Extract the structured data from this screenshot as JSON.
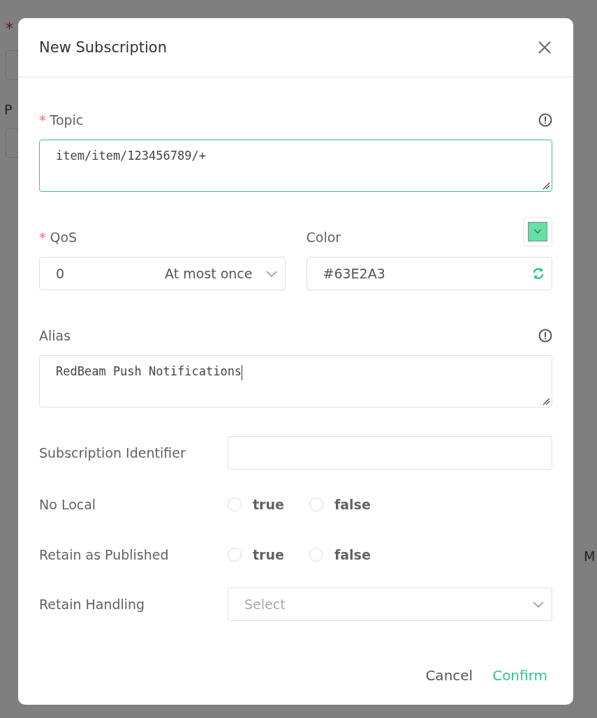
{
  "background": {
    "required_mark": "*",
    "label": "P",
    "column_text": "M"
  },
  "dialog": {
    "title": "New Subscription",
    "topic": {
      "label": "Topic",
      "required": true,
      "value": "item/item/123456789/+"
    },
    "qos": {
      "label": "QoS",
      "required": true,
      "value": "0",
      "option_text": "At most once"
    },
    "color": {
      "label": "Color",
      "value": "#63E2A3"
    },
    "alias": {
      "label": "Alias",
      "value": "RedBeam Push Notifications"
    },
    "subscription_identifier": {
      "label": "Subscription Identifier"
    },
    "radio_rows": [
      {
        "label": "No Local",
        "options": [
          {
            "label": "true",
            "selected": false
          },
          {
            "label": "false",
            "selected": false
          }
        ]
      },
      {
        "label": "Retain as Published",
        "options": [
          {
            "label": "true",
            "selected": false
          },
          {
            "label": "false",
            "selected": false
          }
        ]
      }
    ],
    "retain_handling": {
      "label": "Retain Handling",
      "placeholder": "Select"
    },
    "buttons": [
      {
        "label": "Cancel",
        "kind": "plain"
      },
      {
        "label": "Confirm",
        "kind": "primary"
      }
    ]
  }
}
